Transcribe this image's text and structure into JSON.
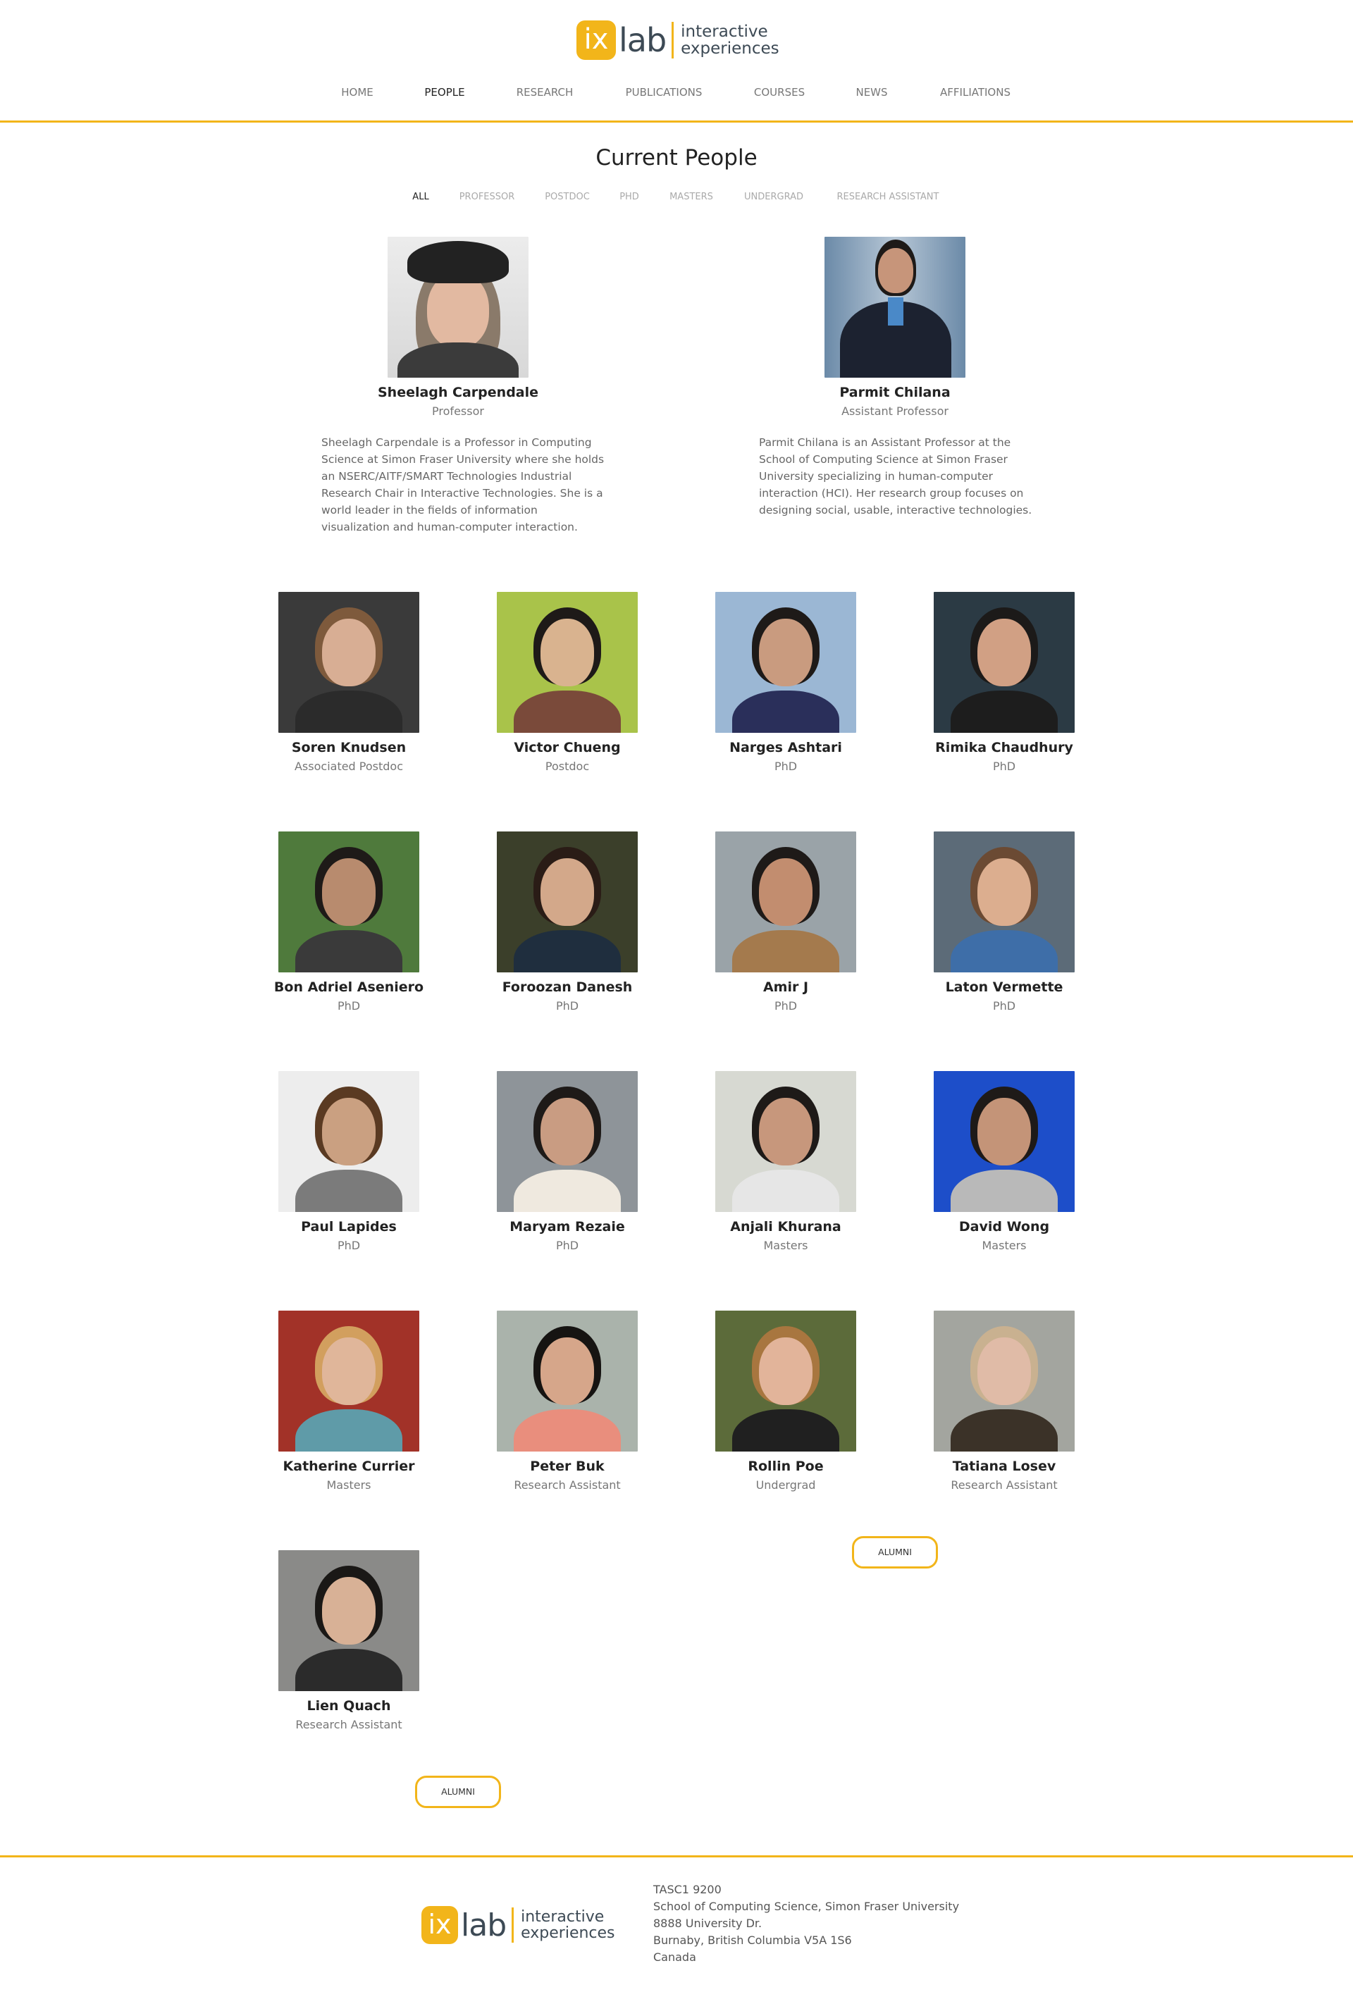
{
  "logo": {
    "mark": "ix",
    "word": "lab",
    "tagline_1": "interactive",
    "tagline_2": "experiences"
  },
  "nav": [
    "HOME",
    "PEOPLE",
    "RESEARCH",
    "PUBLICATIONS",
    "COURSES",
    "NEWS",
    "AFFILIATIONS"
  ],
  "nav_active": "PEOPLE",
  "page_title": "Current People",
  "filters": [
    "ALL",
    "PROFESSOR",
    "POSTDOC",
    "PHD",
    "MASTERS",
    "UNDERGRAD",
    "RESEARCH ASSISTANT"
  ],
  "filter_active": "ALL",
  "faculty": [
    {
      "name": "Sheelagh Carpendale",
      "role": "Professor",
      "bio": [
        "Sheelagh Carpendale is a Professor in Computing",
        "Science at Simon Fraser University where she holds",
        "an NSERC/AITF/SMART Technologies Industrial",
        "Research Chair in Interactive Technologies. She is a",
        "world leader in the fields of information",
        "visualization and human-computer interaction."
      ]
    },
    {
      "name": "Parmit Chilana",
      "role": "Assistant Professor",
      "bio": [
        "Parmit Chilana is an Assistant Professor at the",
        "School of Computing Science at Simon Fraser",
        "University specializing in human-computer",
        "interaction (HCI). Her research group focuses on",
        "designing social, usable, interactive technologies."
      ]
    }
  ],
  "people": [
    {
      "name": "Soren Knudsen",
      "role": "Associated Postdoc"
    },
    {
      "name": "Victor Chueng",
      "role": "Postdoc"
    },
    {
      "name": "Narges Ashtari",
      "role": "PhD"
    },
    {
      "name": "Rimika Chaudhury",
      "role": "PhD"
    },
    {
      "name": "Bon Adriel Aseniero",
      "role": "PhD"
    },
    {
      "name": "Foroozan Danesh",
      "role": "PhD"
    },
    {
      "name": "Amir J",
      "role": "PhD"
    },
    {
      "name": "Laton Vermette",
      "role": "PhD"
    },
    {
      "name": "Paul Lapides",
      "role": "PhD"
    },
    {
      "name": "Maryam Rezaie",
      "role": "PhD"
    },
    {
      "name": "Anjali Khurana",
      "role": "Masters"
    },
    {
      "name": "David Wong",
      "role": "Masters"
    },
    {
      "name": "Katherine Currier",
      "role": "Masters"
    },
    {
      "name": "Peter Buk",
      "role": "Research Assistant"
    },
    {
      "name": "Rollin Poe",
      "role": "Undergrad"
    },
    {
      "name": "Tatiana Losev",
      "role": "Research Assistant"
    },
    {
      "name": "Lien Quach",
      "role": "Research Assistant"
    }
  ],
  "alumni_label": "ALUMNI",
  "footer": {
    "address": [
      "TASC1 9200",
      "School of Computing Science, Simon Fraser University",
      "8888 University Dr.",
      "Burnaby, British Columbia V5A 1S6",
      "Canada"
    ]
  },
  "colors": {
    "accent": "#f2b51a",
    "logo_text": "#3d4a55"
  }
}
